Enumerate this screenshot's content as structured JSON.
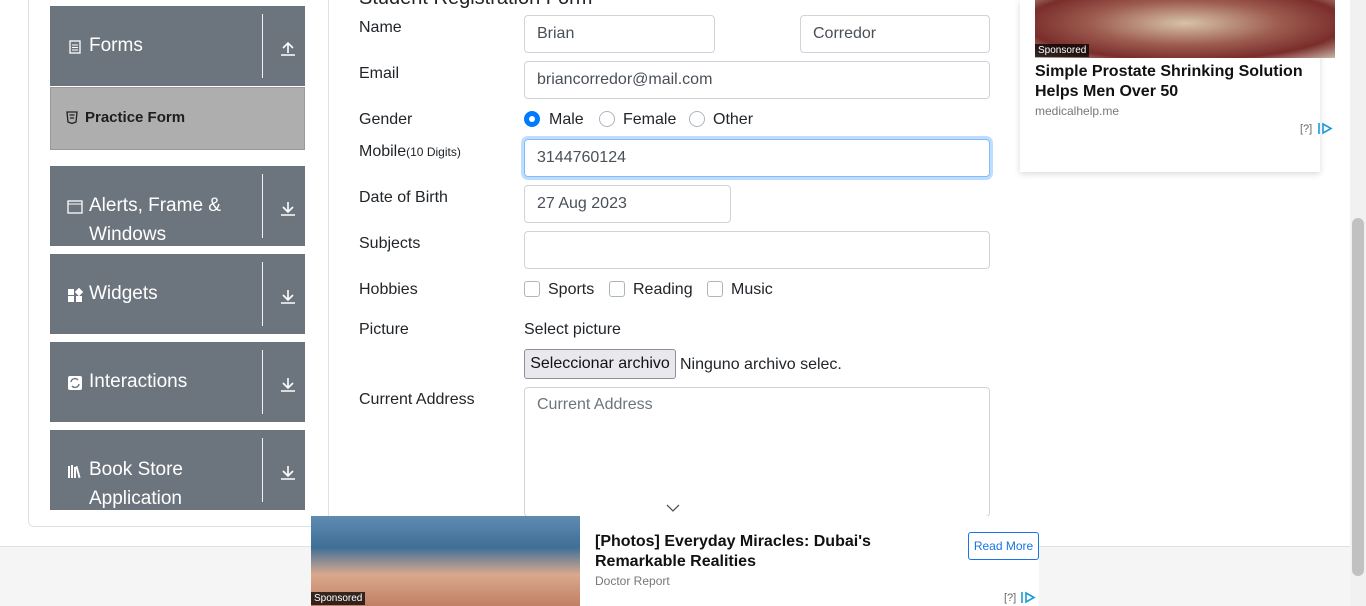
{
  "sidebar": {
    "groups": [
      {
        "label": "Forms",
        "icon": "form-icon",
        "arrow": "collapse-arrow-icon"
      },
      {
        "label": "Alerts, Frame &",
        "label2": "Windows",
        "icon": "window-icon",
        "arrow": "expand-arrow-icon"
      },
      {
        "label": "Widgets",
        "icon": "widgets-icon",
        "arrow": "expand-arrow-icon"
      },
      {
        "label": "Interactions",
        "icon": "interactions-icon",
        "arrow": "expand-arrow-icon"
      },
      {
        "label": "Book Store",
        "label2": "Application",
        "icon": "books-icon",
        "arrow": "expand-arrow-icon"
      }
    ],
    "active_item": {
      "label": "Practice Form",
      "icon": "html5-icon"
    }
  },
  "form": {
    "title": "Student Registration Form",
    "name_label": "Name",
    "first_name": "Brian",
    "last_name": "Corredor",
    "email_label": "Email",
    "email": "briancorredor@mail.com",
    "gender_label": "Gender",
    "gender_options": [
      "Male",
      "Female",
      "Other"
    ],
    "gender_selected": "Male",
    "mobile_label": "Mobile",
    "mobile_hint": "(10 Digits)",
    "mobile": "3144760124",
    "dob_label": "Date of Birth",
    "dob": "27 Aug 2023",
    "subjects_label": "Subjects",
    "subjects": "",
    "hobbies_label": "Hobbies",
    "hobbies": [
      "Sports",
      "Reading",
      "Music"
    ],
    "picture_label": "Picture",
    "select_picture": "Select picture",
    "file_button": "Seleccionar archivo",
    "file_status": "Ninguno archivo selec.",
    "address_label": "Current Address",
    "address_placeholder": "Current Address"
  },
  "ad_right": {
    "sponsored": "Sponsored",
    "headline": "Simple Prostate Shrinking Solution Helps Men Over 50",
    "source": "medicalhelp.me",
    "info": "[?]"
  },
  "ad_bottom": {
    "sponsored": "Sponsored",
    "headline": "[Photos] Everyday Miracles: Dubai's Remarkable Realities",
    "source": "Doctor Report",
    "cta": "Read More",
    "info": "[?]"
  },
  "colors": {
    "sidebar_group": "#6c757d",
    "active_item": "#aeaeae",
    "accent": "#007bff"
  }
}
